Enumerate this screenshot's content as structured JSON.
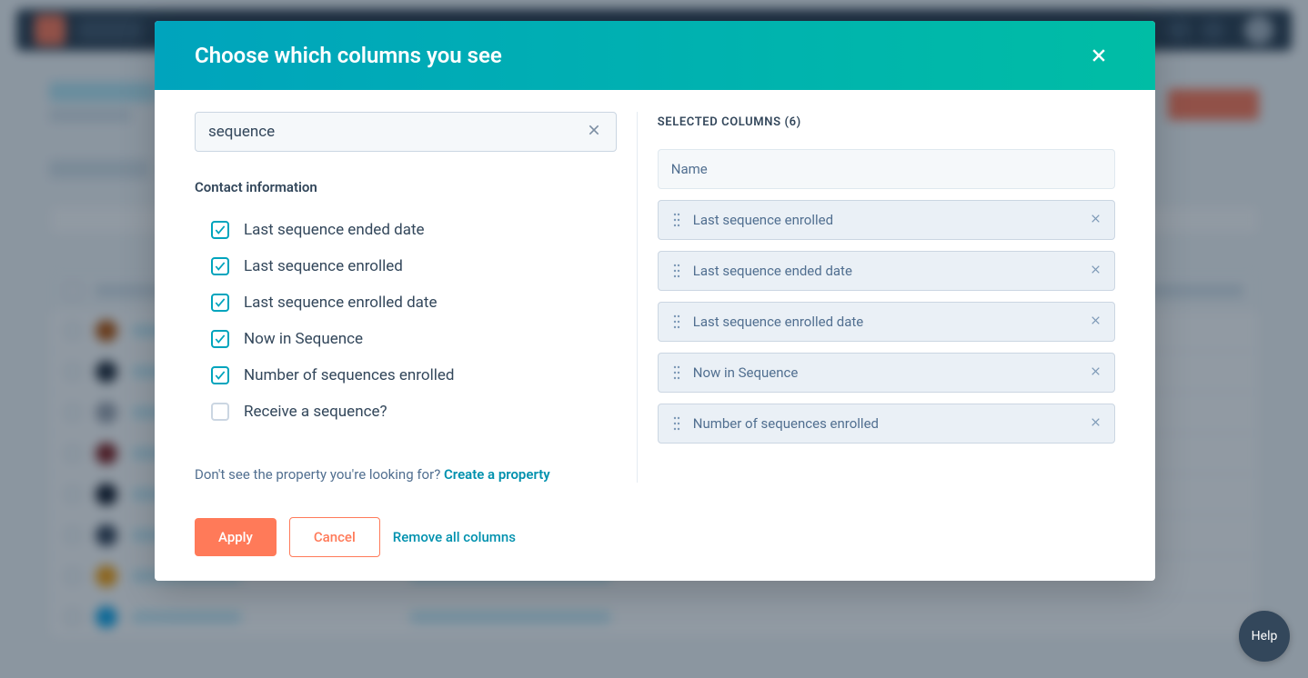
{
  "modal": {
    "title": "Choose which columns you see",
    "search": {
      "value": "sequence"
    },
    "property_group": "Contact information",
    "properties": [
      {
        "label": "Last sequence ended date",
        "checked": true
      },
      {
        "label": "Last sequence enrolled",
        "checked": true
      },
      {
        "label": "Last sequence enrolled date",
        "checked": true
      },
      {
        "label": "Now in Sequence",
        "checked": true
      },
      {
        "label": "Number of sequences enrolled",
        "checked": true
      },
      {
        "label": "Receive a sequence?",
        "checked": false
      }
    ],
    "helper_text": "Don't see the property you're looking for? ",
    "helper_link": "Create a property",
    "selected_heading_prefix": "SELECTED COLUMNS",
    "selected_count": 6,
    "selected": [
      {
        "label": "Name",
        "locked": true
      },
      {
        "label": "Last sequence enrolled",
        "locked": false
      },
      {
        "label": "Last sequence ended date",
        "locked": false
      },
      {
        "label": "Last sequence enrolled date",
        "locked": false
      },
      {
        "label": "Now in Sequence",
        "locked": false
      },
      {
        "label": "Number of sequences enrolled",
        "locked": false
      }
    ],
    "footer": {
      "apply": "Apply",
      "cancel": "Cancel",
      "remove_all": "Remove all columns"
    }
  },
  "help_fab": "Help"
}
